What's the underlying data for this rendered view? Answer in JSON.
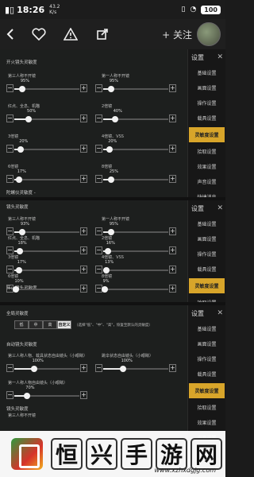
{
  "status": {
    "time": "18:26",
    "net_speed": "43.2",
    "net_unit": "K/s",
    "battery": "100"
  },
  "nav": {
    "follow_label": "+ 关注"
  },
  "sidebar": {
    "title": "设置",
    "items": [
      "基础设置",
      "画面设置",
      "操作设置",
      "载具设置",
      "灵敏度设置",
      "拾取设置",
      "效果设置",
      "声音设置",
      "快捷消息"
    ],
    "active_index": 4
  },
  "panel1": {
    "section_title": "开火镜头灵敏度",
    "section_title_2": "陀螺仪灵敏度 -",
    "rows": [
      {
        "label_left": "第三人称不开镜",
        "pct_left": "95%",
        "level_left": 0.12,
        "label_right": "第一人称不开镜",
        "pct_right": "95%",
        "level_right": 0.12
      },
      {
        "label_left": "红点、全息、机瞄",
        "pct_left": "50%",
        "level_left": 0.22,
        "label_right": "2倍镜",
        "pct_right": "40%",
        "level_right": 0.18
      },
      {
        "label_left": "3倍镜",
        "pct_left": "20%",
        "level_left": 0.1,
        "label_right": "4倍镜、VSS",
        "pct_right": "20%",
        "level_right": 0.1
      },
      {
        "label_left": "6倍镜",
        "pct_left": "17%",
        "level_left": 0.07,
        "label_right": "8倍镜",
        "pct_right": "25%",
        "level_right": 0.12
      }
    ]
  },
  "panel2": {
    "section_title": "镜头灵敏度",
    "footer_title": "开火镜头灵敏度",
    "rows": [
      {
        "label_left": "第三人称不开镜",
        "pct_left": "93%",
        "level_left": 0.12,
        "label_right": "第一人称不开镜",
        "pct_right": "95%",
        "level_right": 0.12
      },
      {
        "label_left": "红点、全息、机瞄",
        "pct_left": "18%",
        "level_left": 0.08,
        "label_right": "2倍镜",
        "pct_right": "16%",
        "level_right": 0.07
      },
      {
        "label_left": "3倍镜",
        "pct_left": "17%",
        "level_left": 0.07,
        "label_right": "4倍镜、VSS",
        "pct_right": "13%",
        "level_right": 0.05
      },
      {
        "label_left": "6倍镜",
        "pct_left": "10%",
        "level_left": 0.03,
        "label_right": "8倍镜",
        "pct_right": "9%",
        "level_right": 0.02
      }
    ]
  },
  "panel3": {
    "section_title": "全局灵敏度",
    "segments": [
      "低",
      "中",
      "高",
      "自定义"
    ],
    "selected_segment": 3,
    "segment_hint": "（选择\"低\"、\"中\"、\"高\"，恢复至默认的灵敏度）",
    "sub_title": "自动镜头灵敏度",
    "rows": [
      {
        "label_left": "第三人称人物、载具状态自由镜头（小眼睛）",
        "pct_left": "100%",
        "level_left": 0.3,
        "label_right": "跳伞状态自由镜头（小眼睛）",
        "pct_right": "100%",
        "level_right": 0.3
      },
      {
        "label_left": "第一人称人物自由镜头（小眼睛）",
        "pct_left": "70%",
        "level_left": 0.2
      }
    ],
    "footer_title": "镜头灵敏度",
    "footer_label": "第三人称不开镜"
  },
  "watermark": {
    "chars": [
      "恒",
      "兴",
      "手",
      "游",
      "网"
    ],
    "url": "www.xzhxdgjg.com"
  },
  "colors": {
    "accent": "#d8a52a",
    "panel_bg": "#1d1f1e"
  }
}
